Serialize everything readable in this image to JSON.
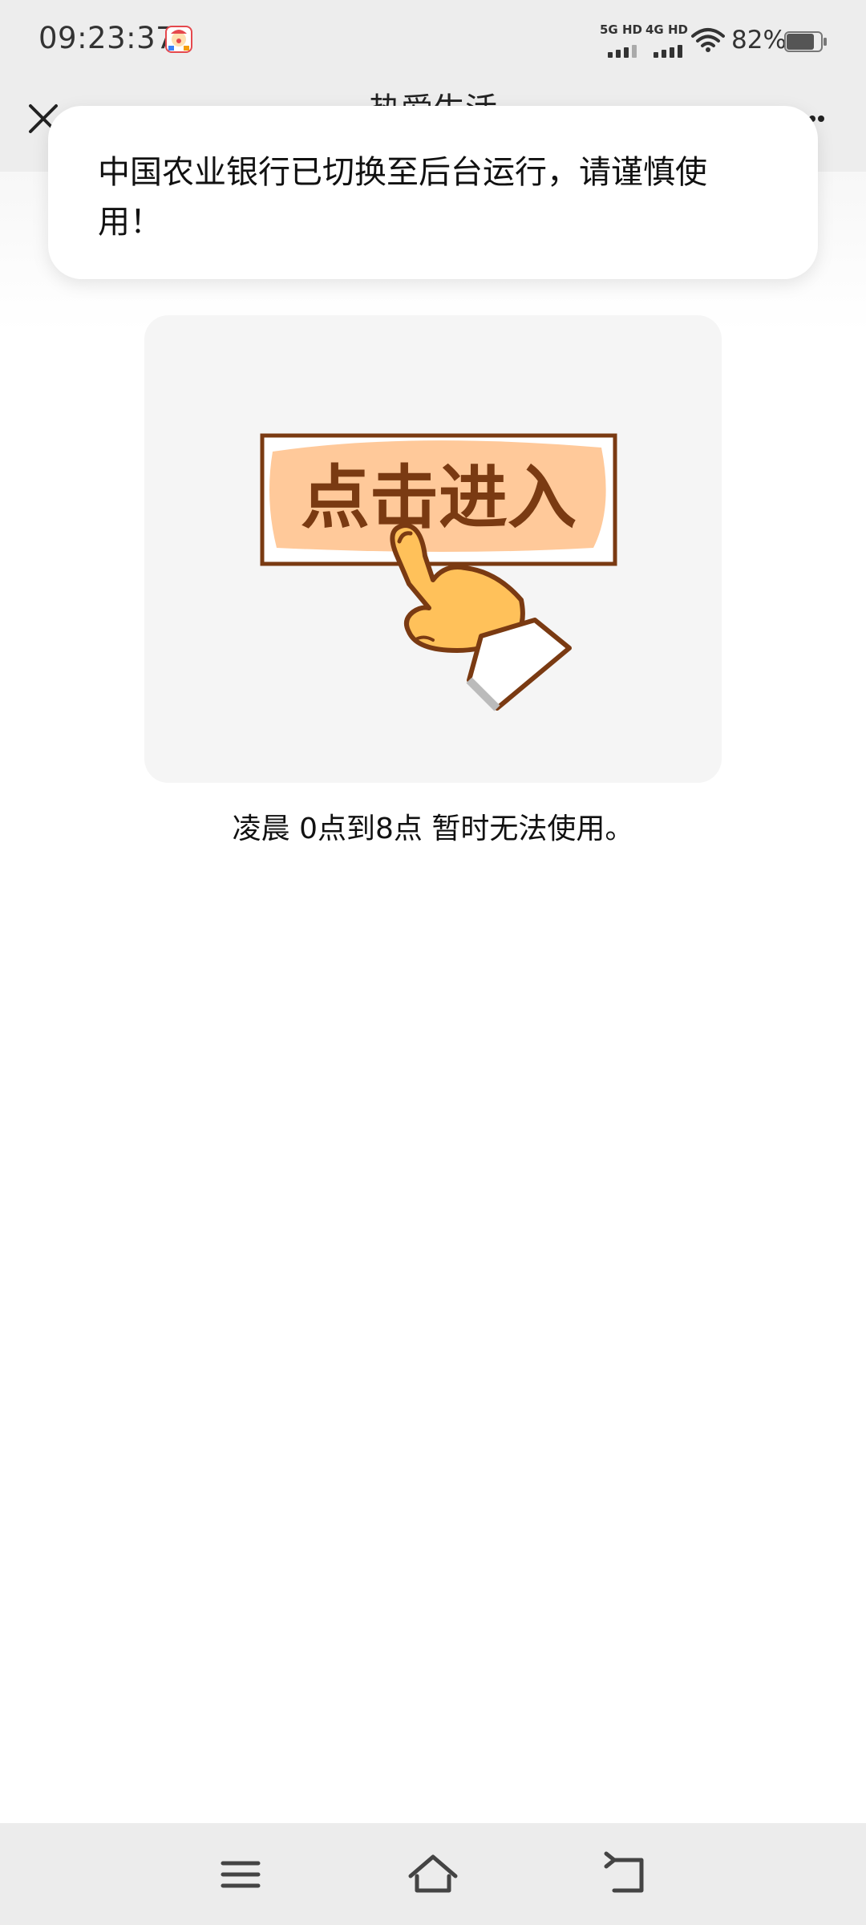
{
  "status_bar": {
    "time": "09:23:37",
    "app_icon": "clown-app-icon",
    "signal_1_label": "5G HD",
    "signal_2_label": "4G HD",
    "wifi_icon": "wifi-icon",
    "battery_percent": "82%",
    "battery_level": 0.82
  },
  "title_bar": {
    "title": "热爱生活",
    "close_icon": "close-icon",
    "more_icon": "more-icon"
  },
  "toast": {
    "message": "中国农业银行已切换至后台运行，请谨慎使用！"
  },
  "content": {
    "banner_text": "点击进入",
    "notice": "凌晨 0点到8点 暂时无法使用。"
  },
  "nav_bar": {
    "menu_icon": "menu-icon",
    "home_icon": "home-icon",
    "back_icon": "back-icon"
  },
  "colors": {
    "bar_background": "#ededed",
    "banner_fill": "#ffc99a",
    "banner_border": "#7a3a12",
    "hand_fill": "#ffc15a"
  }
}
